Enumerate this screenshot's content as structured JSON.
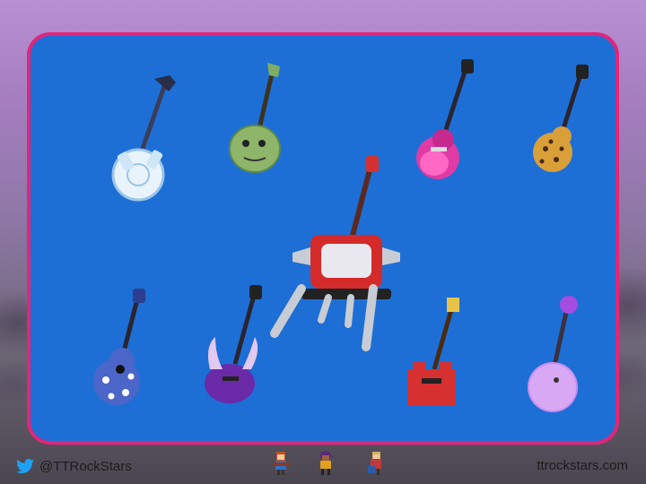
{
  "footer": {
    "twitter_handle": "@TTRockStars",
    "website": "ttrockstars.com"
  },
  "icons": [
    "twitter-bird-icon",
    "rockstar-avatar-icon"
  ],
  "colors": {
    "panel_background": "#1d6fd6",
    "panel_border": "#e0267a"
  },
  "guitars": [
    "star-flying-v-guitar",
    "zombie-head-guitar",
    "pink-burst-les-paul-guitar",
    "leopard-print-guitar",
    "speaker-rig-guitar",
    "floral-acoustic-guitar",
    "purple-horned-guitar",
    "red-pixel-sg-guitar",
    "purple-fuzzy-banjo-guitar"
  ]
}
